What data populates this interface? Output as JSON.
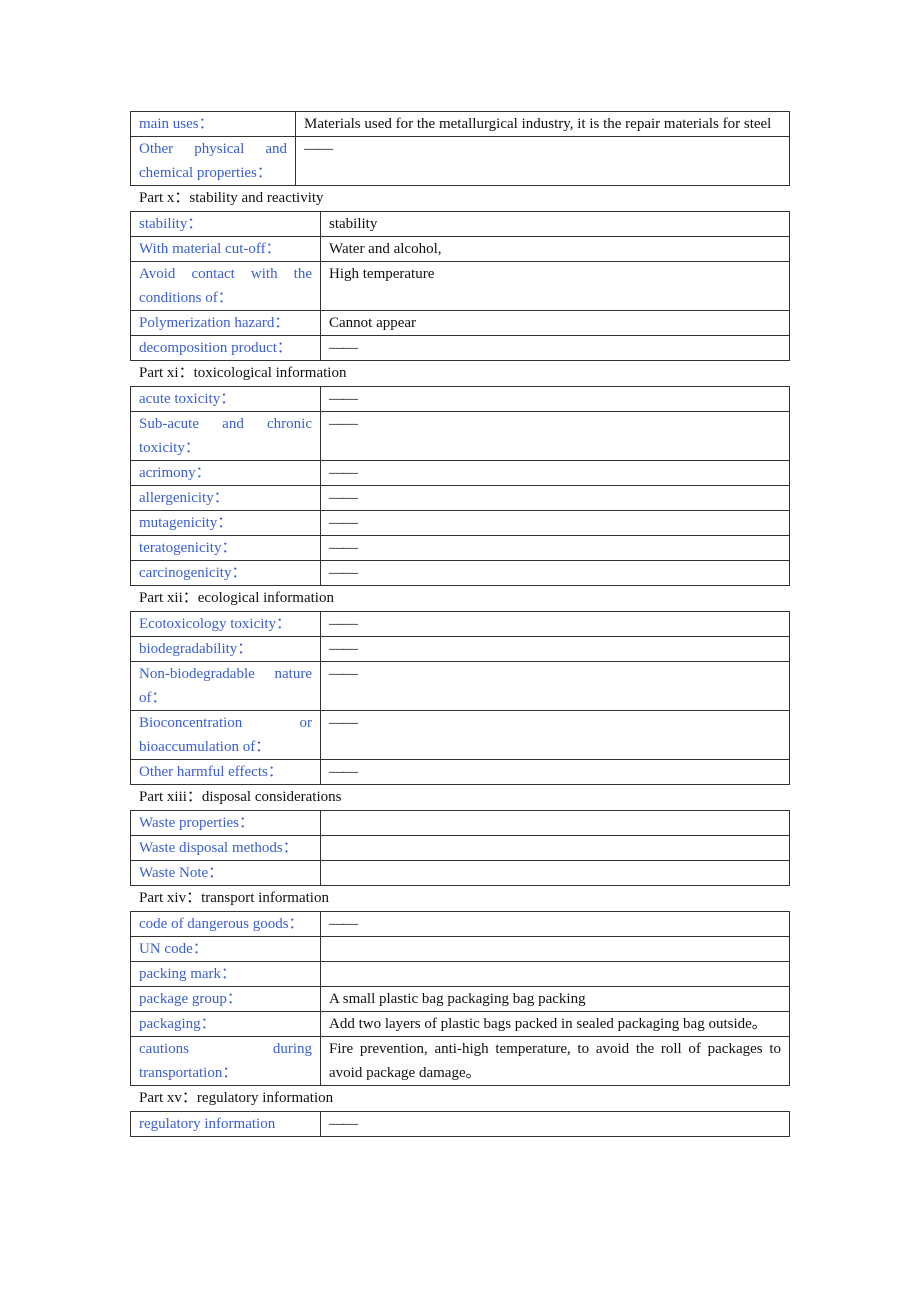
{
  "table_physical": {
    "rows": [
      {
        "label": "main uses：",
        "value": "Materials used for the metallurgical industry, it is the repair materials for steel"
      },
      {
        "label": "Other physical and chemical properties：",
        "value": "——"
      }
    ]
  },
  "sections": [
    {
      "title": "Part x：stability and reactivity",
      "rows": [
        {
          "label": "stability：",
          "value": "stability"
        },
        {
          "label": "With material cut-off：",
          "value": "Water and alcohol,"
        },
        {
          "label": "Avoid contact with the conditions of：",
          "value": "High temperature"
        },
        {
          "label": "Polymerization hazard：",
          "value": "Cannot appear"
        },
        {
          "label": "decomposition product：",
          "value": "——"
        }
      ]
    },
    {
      "title": "Part xi：toxicological information",
      "rows": [
        {
          "label": "acute toxicity：",
          "value": "——"
        },
        {
          "label": "Sub-acute and chronic toxicity：",
          "value": "——"
        },
        {
          "label": "acrimony：",
          "value": "——"
        },
        {
          "label": "allergenicity：",
          "value": "——"
        },
        {
          "label": "mutagenicity：",
          "value": "——"
        },
        {
          "label": "teratogenicity：",
          "value": "——"
        },
        {
          "label": "carcinogenicity：",
          "value": "——"
        }
      ]
    },
    {
      "title": "Part xii：ecological information",
      "rows": [
        {
          "label": "Ecotoxicology toxicity：",
          "value": "——"
        },
        {
          "label": "biodegradability：",
          "value": "——"
        },
        {
          "label": "Non-biodegradable nature of：",
          "value": "——"
        },
        {
          "label": "Bioconcentration or bioaccumulation of：",
          "value": "——"
        },
        {
          "label": "Other harmful effects：",
          "value": "——"
        }
      ]
    },
    {
      "title": "Part xiii：disposal considerations",
      "rows": [
        {
          "label": "Waste properties：",
          "value": ""
        },
        {
          "label": "Waste disposal methods：",
          "value": ""
        },
        {
          "label": "Waste Note：",
          "value": ""
        }
      ]
    },
    {
      "title": "Part xiv：transport information",
      "rows": [
        {
          "label": "code of dangerous goods：",
          "value": "——"
        },
        {
          "label": "UN code：",
          "value": ""
        },
        {
          "label": "packing mark：",
          "value": ""
        },
        {
          "label": "package group：",
          "value": "A small plastic bag packaging bag packing"
        },
        {
          "label": "packaging：",
          "value": "Add two layers of plastic bags packed in sealed packaging bag outside。"
        },
        {
          "label": "cautions during transportation：",
          "value": "Fire prevention, anti-high temperature, to avoid the roll of packages to avoid package damage。"
        }
      ]
    },
    {
      "title": "Part xv：regulatory information",
      "rows": [
        {
          "label": "regulatory information",
          "value": "——"
        }
      ]
    }
  ]
}
